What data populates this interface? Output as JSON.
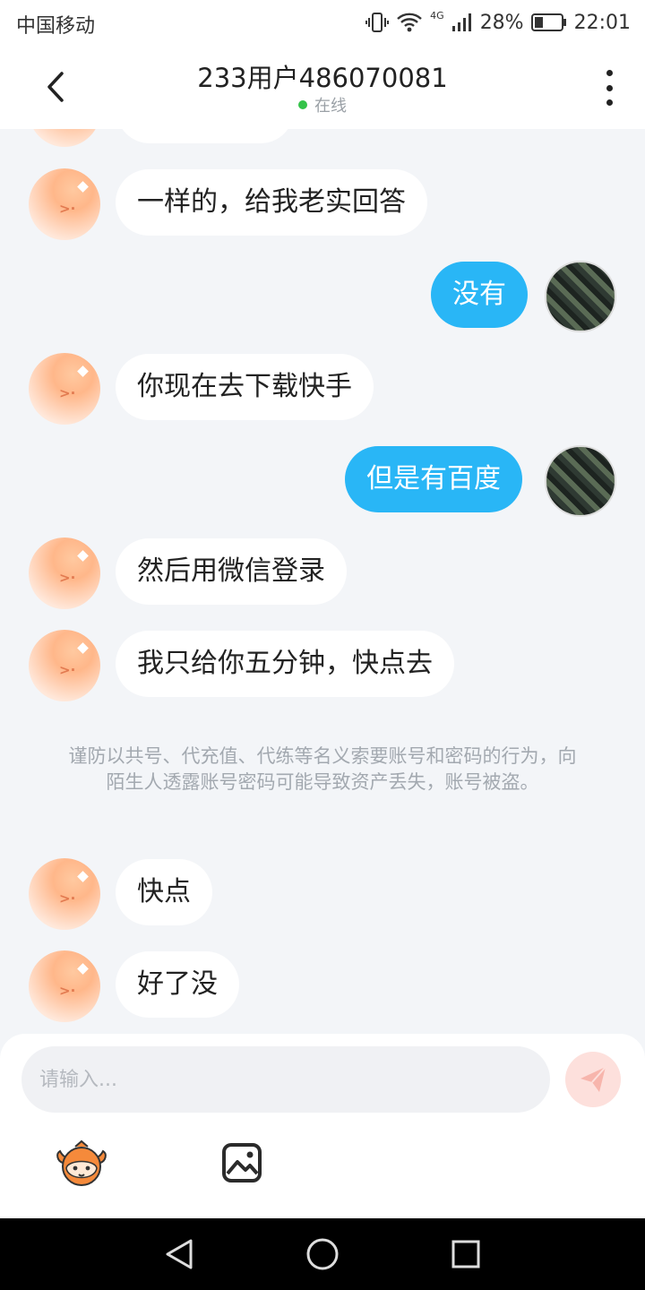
{
  "status_bar": {
    "carrier": "中国移动",
    "network": "4G",
    "battery": "28%",
    "time": "22:01"
  },
  "header": {
    "title": "233用户486070081",
    "status": "在线"
  },
  "messages": [
    {
      "from": "other",
      "text": "一样的，给我老实回答"
    },
    {
      "from": "me",
      "text": "没有"
    },
    {
      "from": "other",
      "text": "你现在去下载快手"
    },
    {
      "from": "me",
      "text": "但是有百度"
    },
    {
      "from": "other",
      "text": "然后用微信登录"
    },
    {
      "from": "other",
      "text": "我只给你五分钟，快点去"
    },
    {
      "from": "other",
      "text": "快点"
    },
    {
      "from": "other",
      "text": "好了没"
    }
  ],
  "notice": "谨防以共号、代充值、代练等名义索要账号和密码的行为，向陌生人透露账号密码可能导致资产丢失，账号被盗。",
  "composer": {
    "placeholder": "请输入..."
  },
  "icons": {
    "back": "back-arrow-icon",
    "more": "more-vertical-icon",
    "send": "paper-plane-icon",
    "image": "image-icon",
    "emoji": "mascot-sticker-icon"
  },
  "colors": {
    "outgoing_bubble": "#29b6f6",
    "incoming_bubble": "#ffffff",
    "online_dot": "#34c34a",
    "background": "#f3f5f8"
  }
}
